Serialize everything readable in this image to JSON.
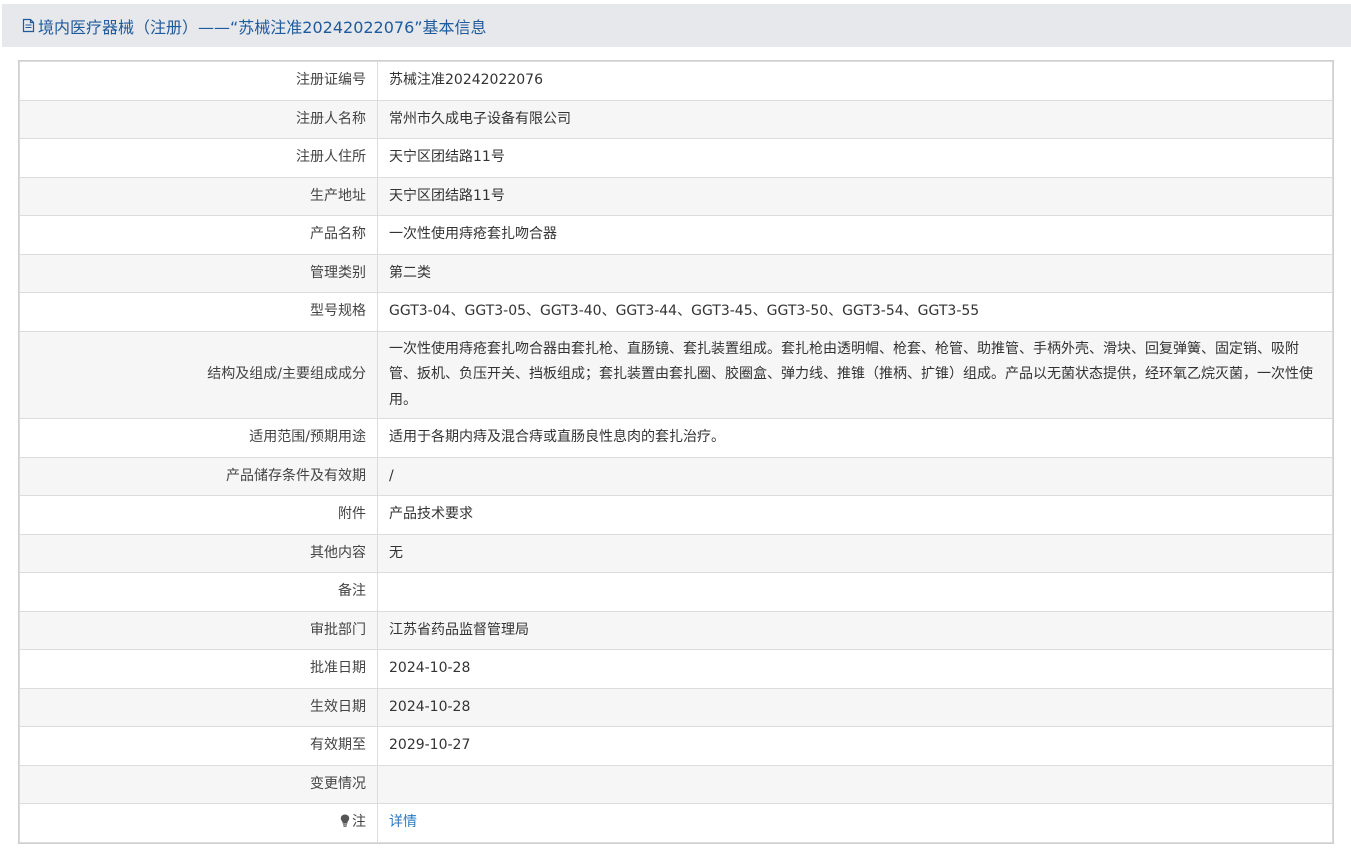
{
  "header": {
    "icon": "document-icon",
    "title": "境内医疗器械（注册）——“苏械注准20242022076”基本信息"
  },
  "rows": [
    {
      "label": "注册证编号",
      "value": "苏械注准20242022076"
    },
    {
      "label": "注册人名称",
      "value": "常州市久成电子设备有限公司"
    },
    {
      "label": "注册人住所",
      "value": "天宁区团结路11号"
    },
    {
      "label": "生产地址",
      "value": "天宁区团结路11号"
    },
    {
      "label": "产品名称",
      "value": "一次性使用痔疮套扎吻合器"
    },
    {
      "label": "管理类别",
      "value": "第二类"
    },
    {
      "label": "型号规格",
      "value": "GGT3-04、GGT3-05、GGT3-40、GGT3-44、GGT3-45、GGT3-50、GGT3-54、GGT3-55"
    },
    {
      "label": "结构及组成/主要组成成分",
      "value": "一次性使用痔疮套扎吻合器由套扎枪、直肠镜、套扎装置组成。套扎枪由透明帽、枪套、枪管、助推管、手柄外壳、滑块、回复弹簧、固定销、吸附管、扳机、负压开关、挡板组成；套扎装置由套扎圈、胶圈盒、弹力线、推锥（推柄、扩锥）组成。产品以无菌状态提供，经环氧乙烷灭菌，一次性使用。"
    },
    {
      "label": "适用范围/预期用途",
      "value": "适用于各期内痔及混合痔或直肠良性息肉的套扎治疗。"
    },
    {
      "label": "产品储存条件及有效期",
      "value": "/"
    },
    {
      "label": "附件",
      "value": "产品技术要求"
    },
    {
      "label": "其他内容",
      "value": "无"
    },
    {
      "label": "备注",
      "value": ""
    },
    {
      "label": "审批部门",
      "value": "江苏省药品监督管理局"
    },
    {
      "label": "批准日期",
      "value": "2024-10-28"
    },
    {
      "label": "生效日期",
      "value": "2024-10-28"
    },
    {
      "label": "有效期至",
      "value": "2029-10-27"
    },
    {
      "label": "变更情况",
      "value": ""
    }
  ],
  "note_row": {
    "icon": "lightbulb-icon",
    "label": "注",
    "link_text": "详情"
  },
  "colors": {
    "header_bg": "#e6e8eb",
    "title": "#1d5a9e",
    "link": "#2a7ac0",
    "row_alt": "#f6f6f6"
  }
}
